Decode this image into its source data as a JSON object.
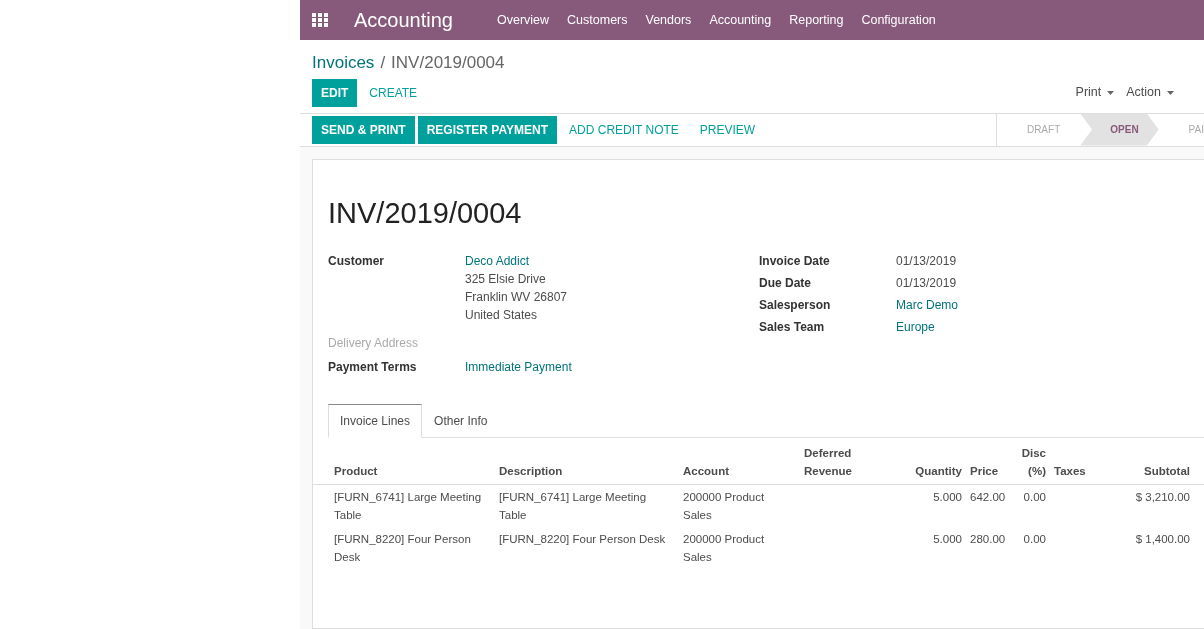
{
  "app": {
    "title": "Accounting",
    "menu": [
      "Overview",
      "Customers",
      "Vendors",
      "Accounting",
      "Reporting",
      "Configuration"
    ]
  },
  "breadcrumb": {
    "parent": "Invoices",
    "separator": "/",
    "current": "INV/2019/0004"
  },
  "control_buttons": [
    {
      "label": "EDIT",
      "kind": "primary"
    },
    {
      "label": "CREATE",
      "kind": "link"
    }
  ],
  "dropdowns": [
    "Print",
    "Action"
  ],
  "header_buttons": [
    {
      "label": "SEND & PRINT",
      "kind": "primary"
    },
    {
      "label": "REGISTER PAYMENT",
      "kind": "primary"
    },
    {
      "label": "ADD CREDIT NOTE",
      "kind": "link"
    },
    {
      "label": "PREVIEW",
      "kind": "link"
    }
  ],
  "statusbar": [
    {
      "label": "DRAFT",
      "selected": false
    },
    {
      "label": "OPEN",
      "selected": true
    },
    {
      "label": "PAI",
      "selected": false
    }
  ],
  "invoice_title": "INV/2019/0004",
  "left_fields": [
    {
      "label": "Customer",
      "values": [
        "Deco Addict",
        "325 Elsie Drive",
        "Franklin WV 26807",
        "United States"
      ],
      "link": true,
      "muted": false
    },
    {
      "label": "Delivery Address",
      "muted": true
    },
    {
      "label": "Payment Terms",
      "values": [
        "Immediate Payment"
      ],
      "link": true,
      "muted": false
    }
  ],
  "right_fields": [
    {
      "label": "Invoice Date",
      "value": "01/13/2019",
      "link": false
    },
    {
      "label": "Due Date",
      "value": "01/13/2019",
      "link": false
    },
    {
      "label": "Salesperson",
      "value": "Marc Demo",
      "link": true
    },
    {
      "label": "Sales Team",
      "value": "Europe",
      "link": true
    }
  ],
  "tabs": [
    {
      "label": "Invoice Lines",
      "selected": true
    },
    {
      "label": "Other Info",
      "selected": false
    }
  ],
  "table": {
    "columns": [
      {
        "label": "Product",
        "kind": "text"
      },
      {
        "label": "Description",
        "kind": "text"
      },
      {
        "label": "Account",
        "kind": "text"
      },
      {
        "label": "Deferred Revenue",
        "kind": "text"
      },
      {
        "label": "Quantity",
        "kind": "number"
      },
      {
        "label": "Price",
        "kind": "text"
      },
      {
        "label": "Disc (%)",
        "kind": "number"
      },
      {
        "label": "Taxes",
        "kind": "text"
      },
      {
        "label": "Subtotal",
        "kind": "number"
      }
    ],
    "rows": [
      [
        "[FURN_6741] Large Meeting Table",
        "[FURN_6741] Large Meeting Table",
        "200000 Product Sales",
        "",
        "5.000",
        "642.00",
        "0.00",
        "",
        "$ 3,210.00"
      ],
      [
        "[FURN_8220] Four Person Desk",
        "[FURN_8220] Four Person Desk",
        "200000 Product Sales",
        "",
        "5.000",
        "280.00",
        "0.00",
        "",
        "$ 1,400.00"
      ]
    ]
  }
}
